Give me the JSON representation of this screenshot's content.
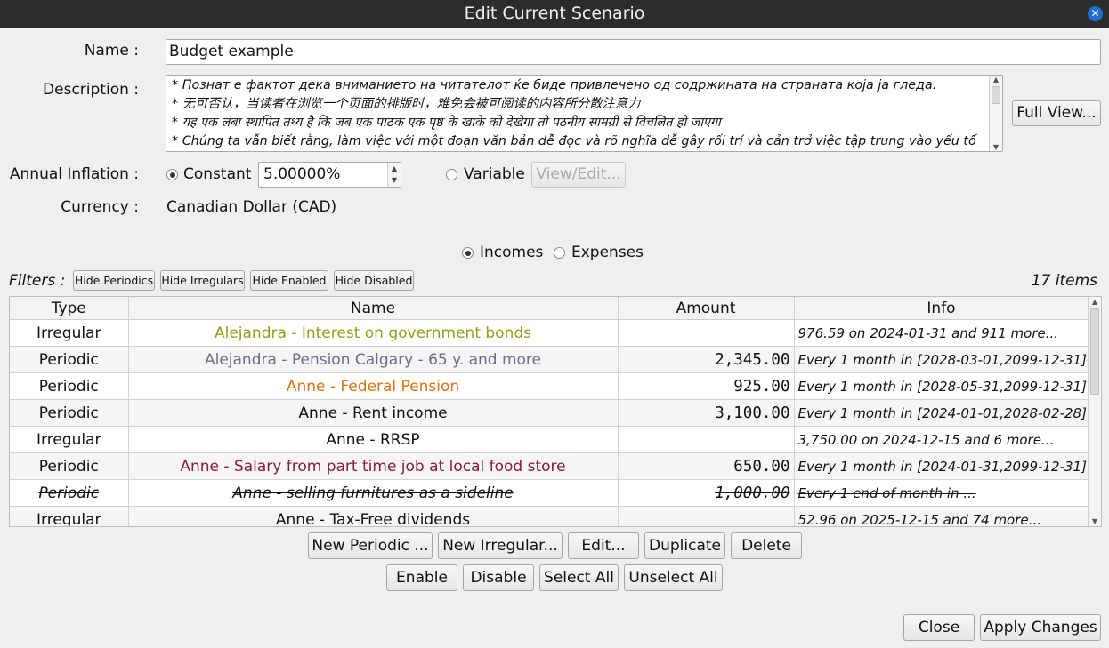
{
  "window": {
    "title": "Edit Current Scenario"
  },
  "form": {
    "name_label": "Name :",
    "name_value": "Budget example",
    "description_label": "Description :",
    "description_lines": [
      "* Познат е фактот дека вниманието на читателот ќе биде привлечено од содржината на страната која ја гледа.",
      "* 无可否认，当读者在浏览一个页面的排版时，难免会被可阅读的内容所分散注意力",
      "* यह एक लंबा स्थापित तथ्य है कि जब एक पाठक एक पृष्ठ के खाके को देखेगा तो पठनीय सामग्री से विचलित हो जाएगा",
      "* Chúng ta vẫn biết rằng, làm việc với một đoạn văn bản dễ đọc và rõ nghĩa dễ gây rối trí và cản trở việc tập trung vào yếu tố"
    ],
    "full_view_label": "Full View...",
    "inflation_label": "Annual Inflation :",
    "constant_label": "Constant",
    "constant_value": "5.00000%",
    "variable_label": "Variable",
    "view_edit_label": "View/Edit...",
    "currency_label": "Currency :",
    "currency_value": "Canadian Dollar (CAD)"
  },
  "mode": {
    "incomes_label": "Incomes",
    "expenses_label": "Expenses",
    "selected": "Incomes"
  },
  "filters": {
    "label": "Filters :",
    "hide_periodics": "Hide Periodics",
    "hide_irregulars": "Hide Irregulars",
    "hide_enabled": "Hide Enabled",
    "hide_disabled": "Hide Disabled",
    "count": "17 items"
  },
  "table": {
    "headers": [
      "Type",
      "Name",
      "Amount",
      "Info"
    ],
    "rows": [
      {
        "type": "Irregular",
        "name": "Alejandra - Interest on government bonds",
        "amount": "",
        "info": "976.59 on 2024-01-31 and 911 more...",
        "color": "#9a9a1a",
        "disabled": false
      },
      {
        "type": "Periodic",
        "name": "Alejandra - Pension Calgary -  65 y. and more",
        "amount": "2,345.00",
        "info": "Every 1 month in [2028-03-01,2099-12-31]",
        "color": "#6e6e8c",
        "disabled": false
      },
      {
        "type": "Periodic",
        "name": "Anne - Federal Pension",
        "amount": "925.00",
        "info": "Every 1 month in [2028-05-31,2099-12-31]",
        "color": "#e07010",
        "disabled": false
      },
      {
        "type": "Periodic",
        "name": "Anne - Rent income",
        "amount": "3,100.00",
        "info": "Every 1 month in [2024-01-01,2028-02-28]",
        "color": "#111111",
        "disabled": false
      },
      {
        "type": "Irregular",
        "name": "Anne - RRSP",
        "amount": "",
        "info": "3,750.00 on 2024-12-15 and 6 more...",
        "color": "#111111",
        "disabled": false
      },
      {
        "type": "Periodic",
        "name": "Anne - Salary from part time job at local food store",
        "amount": "650.00",
        "info": "Every 1 month in [2024-01-31,2099-12-31]",
        "color": "#8a1a3a",
        "disabled": false
      },
      {
        "type": "Periodic",
        "name": "Anne - selling furnitures as a sideline",
        "amount": "1,000.00",
        "info": "Every 1 end of month in ...",
        "color": "#111111",
        "disabled": true
      },
      {
        "type": "Irregular",
        "name": "Anne - Tax-Free dividends",
        "amount": "",
        "info": "52.96 on 2025-12-15 and 74 more...",
        "color": "#111111",
        "disabled": false
      }
    ]
  },
  "actions": {
    "new_periodic": "New Periodic ...",
    "new_irregular": "New Irregular...",
    "edit": "Edit...",
    "duplicate": "Duplicate",
    "delete": "Delete",
    "enable": "Enable",
    "disable": "Disable",
    "select_all": "Select All",
    "unselect_all": "Unselect All",
    "close": "Close",
    "apply": "Apply Changes"
  }
}
